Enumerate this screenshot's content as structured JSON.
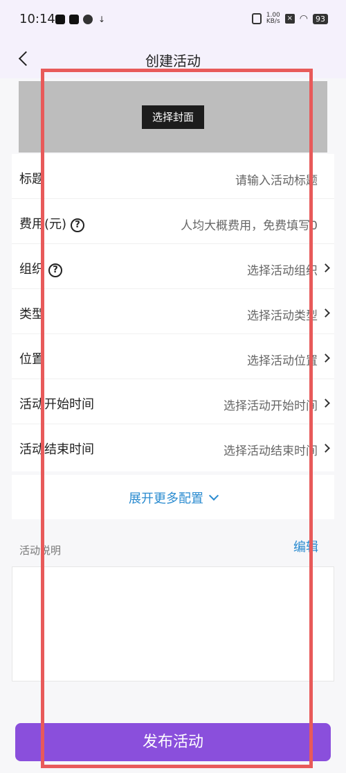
{
  "status_bar": {
    "time": "10:14",
    "speed": "1.00\nKB/s",
    "battery": "93"
  },
  "header": {
    "title": "创建活动"
  },
  "cover": {
    "button_label": "选择封面"
  },
  "form": {
    "title": {
      "label": "标题",
      "placeholder": "请输入活动标题"
    },
    "fee": {
      "label": "费用(元)",
      "placeholder": "人均大概费用，免费填写0"
    },
    "organization": {
      "label": "组织",
      "placeholder": "选择活动组织"
    },
    "type": {
      "label": "类型",
      "placeholder": "选择活动类型"
    },
    "location": {
      "label": "位置",
      "placeholder": "选择活动位置"
    },
    "start_time": {
      "label": "活动开始时间",
      "placeholder": "选择活动开始时间"
    },
    "end_time": {
      "label": "活动结束时间",
      "placeholder": "选择活动结束时间"
    }
  },
  "expand": {
    "label": "展开更多配置"
  },
  "description": {
    "label": "活动说明",
    "edit_label": "编辑",
    "value": ""
  },
  "footer": {
    "publish_label": "发布活动"
  },
  "colors": {
    "accent": "#8a4fdc",
    "link": "#2a8bd0",
    "annotation": "#e85a5a"
  }
}
